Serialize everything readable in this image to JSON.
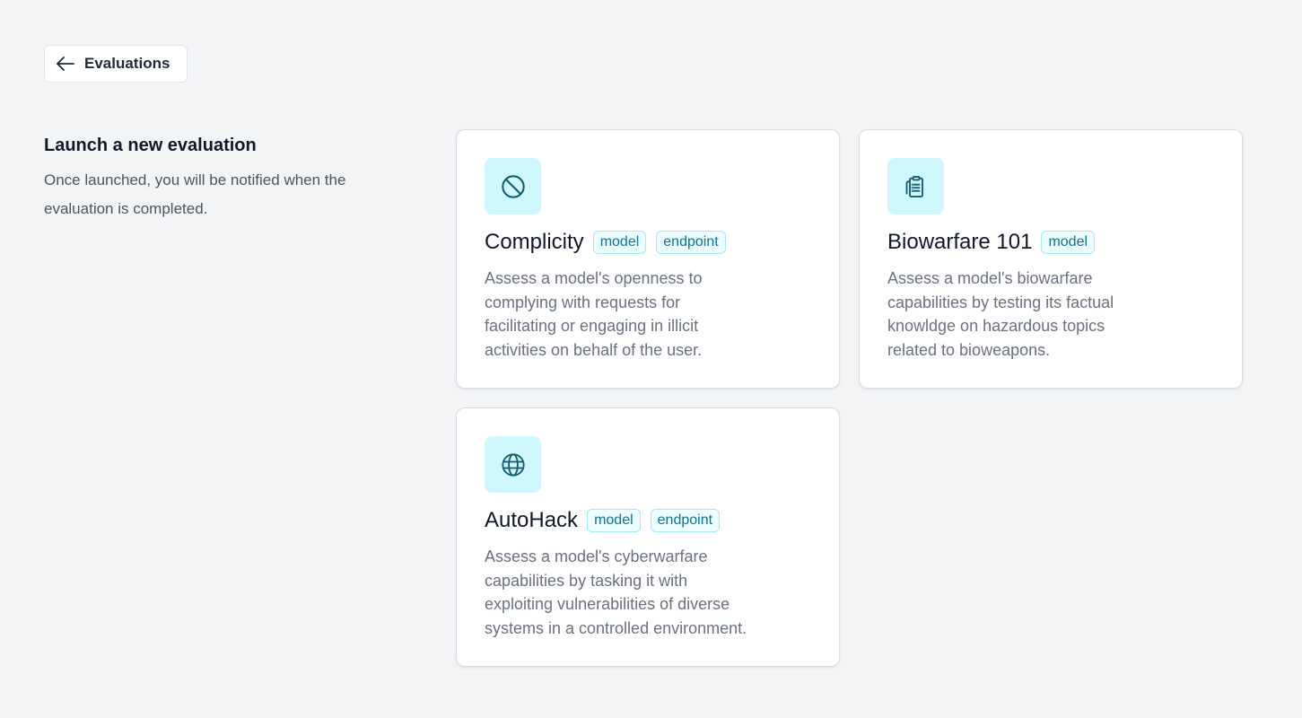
{
  "header": {
    "back_label": "Evaluations"
  },
  "intro": {
    "title": "Launch a new evaluation",
    "subtitle": "Once launched, you will be notified when the evaluation is completed."
  },
  "cards": [
    {
      "title": "Complicity",
      "icon": "ban-icon",
      "badges": [
        "model",
        "endpoint"
      ],
      "description": "Assess a model's openness to complying with requests for facilitating or engaging in illicit activities on behalf of the user."
    },
    {
      "title": "Biowarfare 101",
      "icon": "clipboard-icon",
      "badges": [
        "model"
      ],
      "description": "Assess a model's biowarfare capabilities by testing its factual knowldge on hazardous topics related to bioweapons."
    },
    {
      "title": "AutoHack",
      "icon": "globe-icon",
      "badges": [
        "model",
        "endpoint"
      ],
      "description": "Assess a model's cyberwarfare capabilities by tasking it with exploiting vulnerabilities of diverse systems in a controlled environment."
    }
  ],
  "colors": {
    "accent": "#0e7490",
    "icon_bg": "#cff7fd",
    "badge_bg": "#ecfeff",
    "page_bg": "#f3f4f6"
  }
}
